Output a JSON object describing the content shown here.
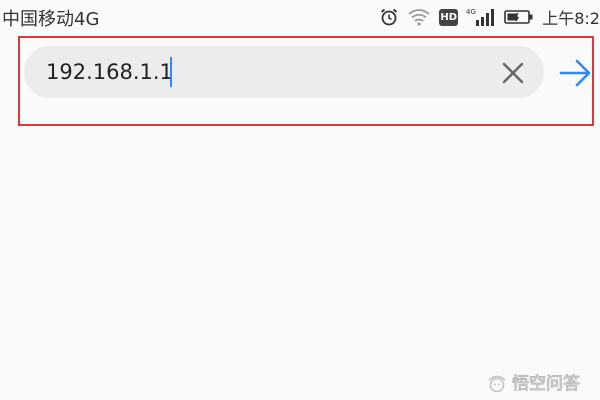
{
  "status_bar": {
    "carrier": "中国移动4G",
    "time": "上午8:2",
    "icons": [
      "alarm-icon",
      "wifi-icon",
      "hd-icon",
      "signal-4g-icon",
      "battery-icon"
    ],
    "hd_label": "HD"
  },
  "address_bar": {
    "url": "192.168.1.1",
    "clear_icon": "close-icon",
    "go_icon": "arrow-right-icon",
    "highlight_color": "#e0353a",
    "accent_color": "#2b8af7"
  },
  "watermark": {
    "text": "悟空问答"
  }
}
